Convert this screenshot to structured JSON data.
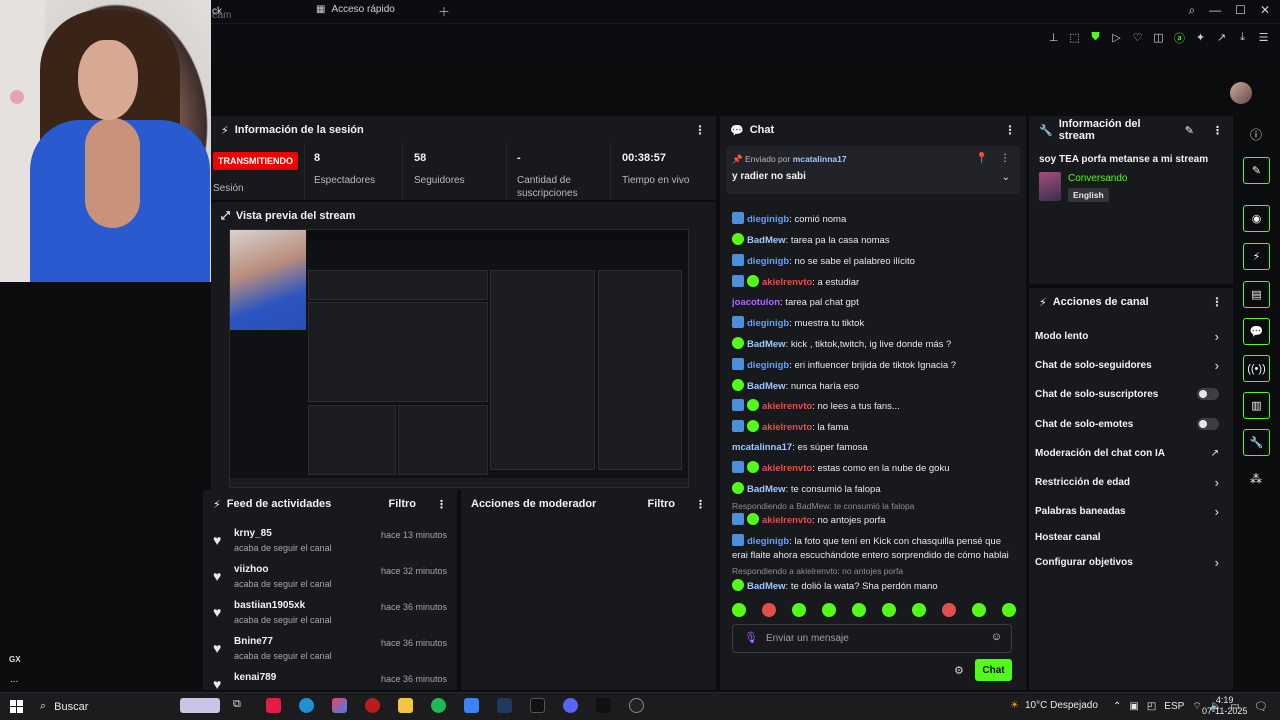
{
  "browser": {
    "tab_fragment": "ck",
    "quick_access_tab": "Acceso rápido",
    "address_fragment": "eam"
  },
  "webcam": {
    "label": ""
  },
  "sidebar_left": {
    "gx": "GX",
    "more": "..."
  },
  "session": {
    "title": "Información de la sesión",
    "live_badge": "TRANSMITIENDO",
    "session_label": "Sesión",
    "viewers_value": "8",
    "viewers_label": "Espectadores",
    "followers_value": "58",
    "followers_label": "Seguidores",
    "subs_value": "-",
    "subs_label": "Cantidad de suscripciones",
    "uptime_value": "00:38:57",
    "uptime_label": "Tiempo en vivo"
  },
  "preview": {
    "title": "Vista previa del stream"
  },
  "feed": {
    "title": "Feed de actividades",
    "filter": "Filtro",
    "items": [
      {
        "name": "krny_85",
        "sub": "acaba de seguir el canal",
        "time": "hace 13 minutos"
      },
      {
        "name": "viizhoo",
        "sub": "acaba de seguir el canal",
        "time": "hace 32 minutos"
      },
      {
        "name": "bastiian1905xk",
        "sub": "acaba de seguir el canal",
        "time": "hace 36 minutos"
      },
      {
        "name": "Bnine77",
        "sub": "acaba de seguir el canal",
        "time": "hace 36 minutos"
      },
      {
        "name": "kenai789",
        "sub": "",
        "time": "hace 36 minutos"
      }
    ]
  },
  "moderator": {
    "title": "Acciones de moderador",
    "filter": "Filtro"
  },
  "chat": {
    "title": "Chat",
    "pinned_by_prefix": "Enviado por",
    "pinned_by_user": "mcatalinna17",
    "pinned_message": "y radier no sabi",
    "messages": [
      {
        "user": "dieginigb",
        "text": ": comió noma",
        "color": "blue",
        "badge": "blue"
      },
      {
        "user": "BadMew",
        "text": ": tarea pa la casa nomas",
        "color": "light",
        "badge": "green"
      },
      {
        "user": "dieginigb",
        "text": ": no se sabe el palabreo ilícito",
        "color": "blue",
        "badge": "blue"
      },
      {
        "user": "akielrenvto",
        "text": ": a estudiar",
        "color": "red",
        "badge": "both"
      },
      {
        "user": "joacotulon",
        "text": ": tarea pal chat gpt",
        "color": "purple",
        "badge": "none"
      },
      {
        "user": "dieginigb",
        "text": ": muestra tu tiktok",
        "color": "blue",
        "badge": "blue"
      },
      {
        "user": "BadMew",
        "text": ": kick , tiktok,twitch, ig live donde más ?",
        "color": "light",
        "badge": "green"
      },
      {
        "user": "dieginigb",
        "text": ": eri influencer brijida de tiktok Ignacia ?",
        "color": "blue",
        "badge": "blue"
      },
      {
        "user": "BadMew",
        "text": ": nunca haría eso",
        "color": "light",
        "badge": "green"
      },
      {
        "user": "akielrenvto",
        "text": ": no lees a tus fans...",
        "color": "red",
        "badge": "both"
      },
      {
        "user": "akielrenvto",
        "text": ": la fama",
        "color": "red",
        "badge": "both"
      },
      {
        "user": "mcatalinna17",
        "text": ": es súper famosa",
        "color": "light",
        "badge": "none"
      },
      {
        "user": "akielrenvto",
        "text": ": estas como en la nube de goku",
        "color": "red",
        "badge": "both"
      },
      {
        "user": "BadMew",
        "text": ": te consumió la falopa",
        "color": "light",
        "badge": "green"
      },
      {
        "user": "akielrenvto",
        "text": ": no antojes porfa",
        "color": "red",
        "badge": "both"
      },
      {
        "user": "dieginigb",
        "text": ": la foto que tení en Kick con chasquilla pensé que erai flaite ahora escuchándote entero sorprendido de cómo hablai",
        "color": "blue",
        "badge": "blue"
      },
      {
        "user": "BadMew",
        "text": ": te dolió la wata? Sha perdón mano",
        "color": "light",
        "badge": "green"
      }
    ],
    "reply_1": "Respondiendo a BadMew: te consumió la falopa",
    "reply_2": "Respondiendo a akielrenvto: no antojes porfa",
    "input_placeholder": "Enviar un mensaje",
    "send_label": "Chat"
  },
  "stream_info": {
    "title": "Información del stream",
    "stream_title": "soy TEA porfa metanse a mi stream",
    "category": "Conversando",
    "language": "English"
  },
  "channel_actions": {
    "title": "Acciones de canal",
    "items": [
      {
        "label": "Modo lento",
        "control": "chevron"
      },
      {
        "label": "Chat de solo-seguidores",
        "control": "chevron"
      },
      {
        "label": "Chat de solo-suscriptores",
        "control": "toggle"
      },
      {
        "label": "Chat de solo-emotes",
        "control": "toggle"
      },
      {
        "label": "Moderación del chat con IA",
        "control": "external"
      },
      {
        "label": "Restricción de edad",
        "control": "chevron"
      },
      {
        "label": "Palabras baneadas",
        "control": "chevron"
      },
      {
        "label": "Hostear canal",
        "control": "none"
      },
      {
        "label": "Configurar objetivos",
        "control": "chevron"
      }
    ]
  },
  "taskbar": {
    "search": "Buscar",
    "weather": "10°C  Despejado",
    "lang": "ESP",
    "time": "4:19",
    "date": "07-11-2025"
  },
  "colors": {
    "accent": "#53fc18",
    "live": "#eb0400",
    "panel": "#18191d",
    "bg": "#0b0c0e"
  }
}
